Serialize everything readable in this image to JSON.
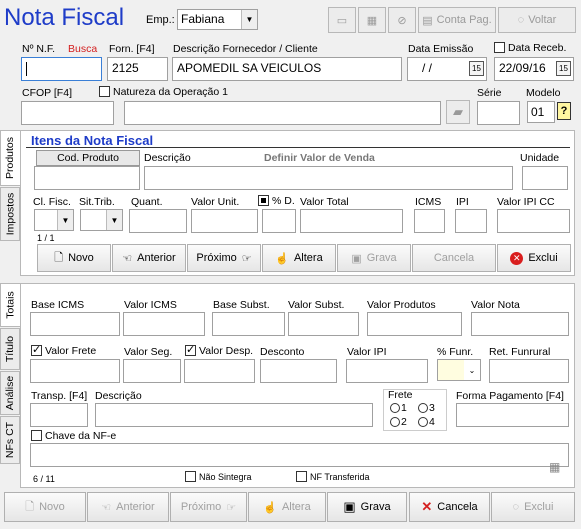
{
  "title": "Nota Fiscal",
  "emp": {
    "label": "Emp.:",
    "value": "Fabiana"
  },
  "toolbar": {
    "conta_pag": "Conta Pag.",
    "voltar": "Voltar"
  },
  "header": {
    "nf_label": "Nº N.F.",
    "busca": "Busca",
    "nf_value": "",
    "forn_label": "Forn. [F4]",
    "forn_value": "2125",
    "desc_label": "Descrição Fornecedor / Cliente",
    "desc_value": "APOMEDIL SA VEICULOS",
    "data_emissao_label": "Data Emissão",
    "data_emissao_value": " / /",
    "data_receb_label": "Data Receb.",
    "data_receb_value": "22/09/16",
    "cfop_label": "CFOP [F4]",
    "natureza_label": "Natureza da Operação 1",
    "serie_label": "Série",
    "modelo_label": "Modelo",
    "modelo_value": "01"
  },
  "tabs": [
    "Produtos",
    "Impostos",
    "Totais",
    "Título",
    "Análise",
    "NFs CT"
  ],
  "itens": {
    "title": "Itens da Nota Fiscal",
    "cod_produto": "Cod. Produto",
    "descricao": "Descrição",
    "definir": "Definir Valor de Venda",
    "unidade": "Unidade",
    "cl_fisc": "Cl. Fisc.",
    "sit_trib": "Sit.Trib.",
    "quant": "Quant.",
    "valor_unit": "Valor Unit.",
    "perc_d": "% D.",
    "valor_total": "Valor Total",
    "icms": "ICMS",
    "ipi": "IPI",
    "valor_ipi_cc": "Valor IPI CC",
    "counter": "1 / 1"
  },
  "item_buttons": {
    "novo": "Novo",
    "anterior": "Anterior",
    "proximo": "Próximo",
    "altera": "Altera",
    "grava": "Grava",
    "cancela": "Cancela",
    "exclui": "Exclui"
  },
  "totais": {
    "base_icms": "Base ICMS",
    "valor_icms": "Valor ICMS",
    "base_subst": "Base Subst.",
    "valor_subst": "Valor Subst.",
    "valor_produtos": "Valor Produtos",
    "valor_nota": "Valor Nota",
    "valor_frete": "Valor Frete",
    "valor_seg": "Valor Seg.",
    "valor_desp": "Valor Desp.",
    "desconto": "Desconto",
    "valor_ipi": "Valor IPI",
    "perc_funr": "% Funr.",
    "ret_funrural": "Ret. Funrural",
    "transp": "Transp. [F4]",
    "descricao": "Descrição",
    "frete": "Frete",
    "frete_opts": [
      "1",
      "2",
      "3",
      "4"
    ],
    "forma_pagamento": "Forma Pagamento [F4]",
    "chave": "Chave da NF-e",
    "counter": "6 / 11",
    "nao_sintegra": "Não Sintegra",
    "nf_transferida": "NF Transferida"
  },
  "bottom_buttons": {
    "novo": "Novo",
    "anterior": "Anterior",
    "proximo": "Próximo",
    "altera": "Altera",
    "grava": "Grava",
    "cancela": "Cancela",
    "exclui": "Exclui"
  }
}
